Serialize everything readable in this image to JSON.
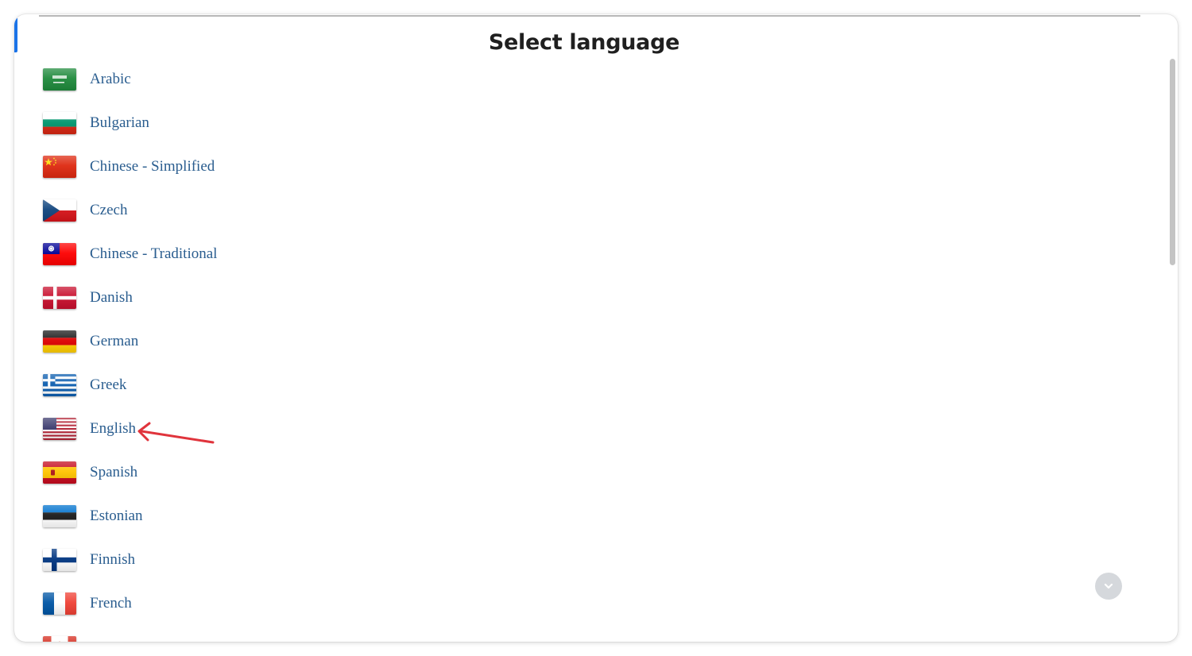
{
  "dialog": {
    "title": "Select language"
  },
  "languages": [
    {
      "label": "Arabic",
      "flag": "saudi-arabia-flag-icon"
    },
    {
      "label": "Bulgarian",
      "flag": "bulgaria-flag-icon"
    },
    {
      "label": "Chinese - Simplified",
      "flag": "china-flag-icon"
    },
    {
      "label": "Czech",
      "flag": "czech-flag-icon"
    },
    {
      "label": "Chinese - Traditional",
      "flag": "taiwan-flag-icon"
    },
    {
      "label": "Danish",
      "flag": "denmark-flag-icon"
    },
    {
      "label": "German",
      "flag": "germany-flag-icon"
    },
    {
      "label": "Greek",
      "flag": "greece-flag-icon"
    },
    {
      "label": "English",
      "flag": "usa-flag-icon"
    },
    {
      "label": "Spanish",
      "flag": "spain-flag-icon"
    },
    {
      "label": "Estonian",
      "flag": "estonia-flag-icon"
    },
    {
      "label": "Finnish",
      "flag": "finland-flag-icon"
    },
    {
      "label": "French",
      "flag": "france-flag-icon"
    },
    {
      "label": "",
      "flag": "canada-flag-icon"
    }
  ],
  "colors": {
    "accent": "#1a73e8",
    "link": "#2a5d8f",
    "annotation_arrow": "#e0343c"
  },
  "icons": {
    "scroll_down": "chevron-down-icon",
    "annotation": "red-arrow-icon"
  }
}
